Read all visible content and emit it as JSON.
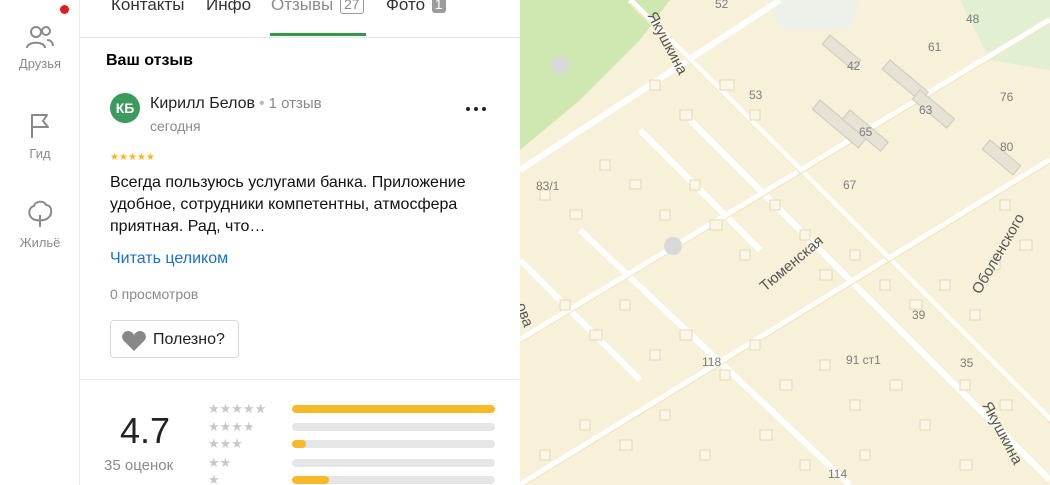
{
  "rail": {
    "items": [
      {
        "label": "Друзья"
      },
      {
        "label": "Гид"
      },
      {
        "label": "Жильё"
      }
    ]
  },
  "tabs": [
    {
      "label": "Контакты"
    },
    {
      "label": "Инфо"
    },
    {
      "label": "Отзывы",
      "count": "27",
      "active": true
    },
    {
      "label": "Фото",
      "count": "1"
    }
  ],
  "review": {
    "section_title": "Ваш отзыв",
    "avatar_initials": "КБ",
    "author": "Кирилл Белов",
    "author_reviews": "1 отзыв",
    "date": "сегодня",
    "rating": 5,
    "text": "Всегда пользуюсь услугами банка. Приложение удобное, сотрудники компетентны, атмосфера приятная. Рад, что…",
    "read_more": "Читать целиком",
    "views": "0 просмотров",
    "useful_label": "Полезно?"
  },
  "summary": {
    "rating": "4.7",
    "count_label": "35 оценок",
    "distribution": [
      {
        "stars": 5,
        "fraction": 1.0
      },
      {
        "stars": 4,
        "fraction": 0.0
      },
      {
        "stars": 3,
        "fraction": 0.07
      },
      {
        "stars": 2,
        "fraction": 0.0
      },
      {
        "stars": 1,
        "fraction": 0.18
      }
    ]
  },
  "map": {
    "streets": [
      "Якушкина",
      "Тюменская",
      "Оболенского",
      "Якушкина",
      "ова"
    ],
    "labels": [
      "52",
      "48",
      "42",
      "61",
      "53",
      "63",
      "76",
      "65",
      "80",
      "83/1",
      "67",
      "39",
      "118",
      "91 ст1",
      "35",
      "114"
    ]
  },
  "colors": {
    "accent": "#2f9c45",
    "link": "#1a6fd1",
    "star": "#f6b91b",
    "avatar": "#3c9a5c",
    "map_bg": "#f7f1d9",
    "notification": "#e01c1c"
  }
}
